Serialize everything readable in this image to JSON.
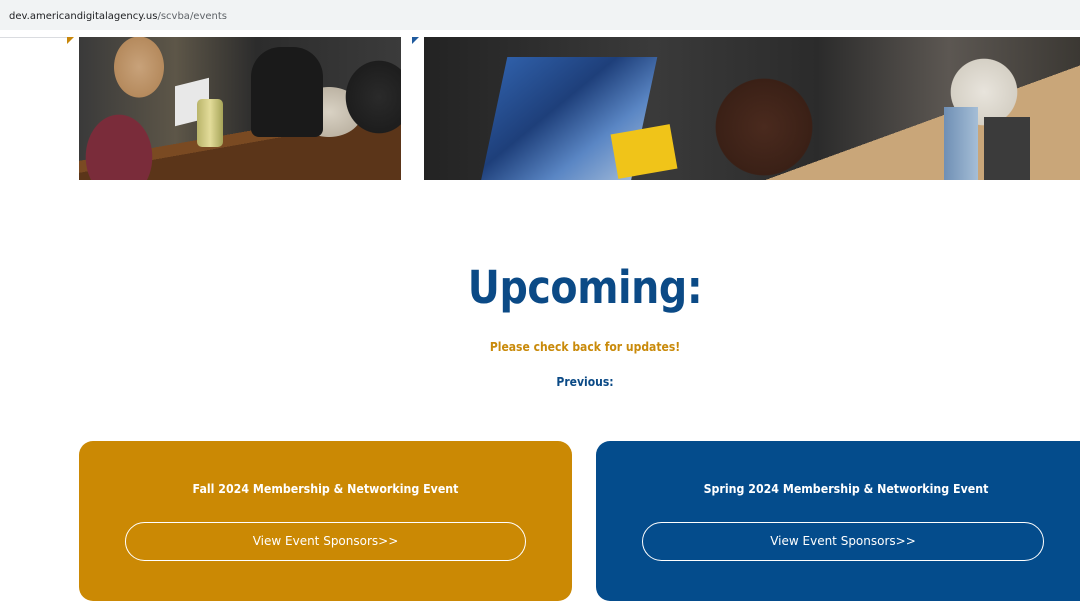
{
  "browser": {
    "url_domain": "dev.americandigitalagency.us",
    "url_path": "/scvba/events"
  },
  "colors": {
    "navy": "#0b4a86",
    "gold": "#cb8904",
    "card_blue": "#044c8c"
  },
  "upcoming": {
    "title": "Upcoming:",
    "message": "Please check back for updates!"
  },
  "previous": {
    "heading": "Previous:",
    "events": [
      {
        "title": "Fall 2024 Membership & Networking Event",
        "button_label": "View Event Sponsors>>"
      },
      {
        "title": "Spring 2024 Membership & Networking Event",
        "button_label": "View Event Sponsors>>"
      }
    ]
  }
}
